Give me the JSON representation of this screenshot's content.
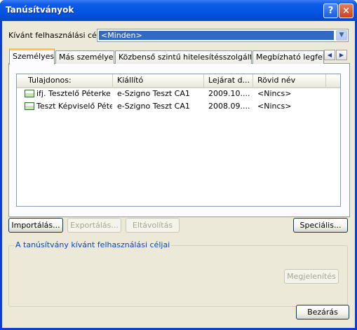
{
  "window": {
    "title": "Tanúsítványok",
    "help_label": "?",
    "close_label": "×"
  },
  "purpose": {
    "label": "Kívánt felhasználási cél:",
    "value": "<Minden>"
  },
  "tabs": [
    {
      "label": "Személyes",
      "active": true
    },
    {
      "label": "Más személyek",
      "active": false
    },
    {
      "label": "Közbenső szintű hitelesítésszolgáltatók",
      "active": false
    },
    {
      "label": "Megbízható legfelső",
      "active": false
    }
  ],
  "tab_scroll": {
    "left": "◀",
    "right": "▶"
  },
  "table": {
    "columns": [
      "Tulajdonos:",
      "Kiállító",
      "Lejárat d...",
      "Rövid név"
    ],
    "rows": [
      {
        "owner": "ifj. Tesztelő Péterke",
        "issuer": "e-Szigno Teszt CA1",
        "expiry": "2009.10....",
        "friendly": "<Nincs>"
      },
      {
        "owner": "Teszt Képviselő Péter",
        "issuer": "e-Szigno Teszt CA1",
        "expiry": "2008.09....",
        "friendly": "<Nincs>"
      }
    ]
  },
  "buttons": {
    "import": "Importálás...",
    "export": "Exportálás...",
    "remove": "Eltávolítás",
    "advanced": "Speciális...",
    "view": "Megjelenítés",
    "close": "Bezárás"
  },
  "group": {
    "title": "A tanúsítvány kívánt felhasználási céljai"
  },
  "colors": {
    "titlebar": "#0454e3",
    "dialog_bg": "#ece9d8",
    "selection": "#316ac5",
    "group_title": "#0046d5",
    "active_tab_accent": "#ffc83c"
  },
  "icons": {
    "certificate": "certificate-icon",
    "dropdown": "chevron-down-icon"
  }
}
